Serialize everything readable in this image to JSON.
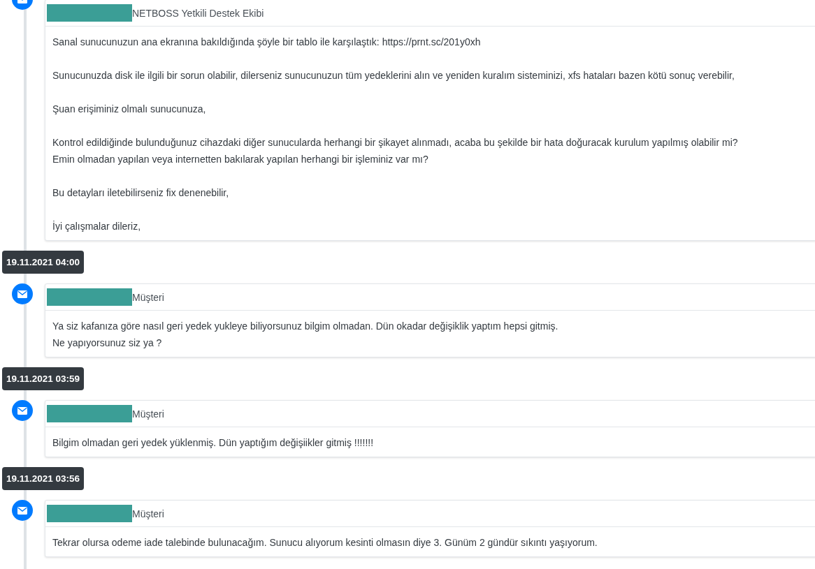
{
  "timeline": [
    {
      "kind": "message",
      "author": "NETBOSS Yetkili Destek Ekibi",
      "paragraphs": [
        [
          "Sanal sunucunuzun ana ekranına bakıldığında şöyle bir tablo ile karşılaştık: https://prnt.sc/201y0xh"
        ],
        [
          "Sunucunuzda disk ile ilgili bir sorun olabilir, dilerseniz sunucunuzun tüm yedeklerini alın ve yeniden kuralım sisteminizi, xfs hataları bazen kötü sonuç verebilir,"
        ],
        [
          "Şuan erişiminiz olmalı sunucunuza,"
        ],
        [
          "Kontrol edildiğinde bulunduğunuz cihazdaki diğer sunucularda herhangi bir şikayet alınmadı, acaba bu şekilde bir hata doğuracak kurulum yapılmış olabilir mi?",
          "Emin olmadan yapılan veya internetten bakılarak yapılan herhangi bir işleminiz var mı?"
        ],
        [
          "Bu detayları iletebilirseniz fix denenebilir,"
        ],
        [
          "İyi çalışmalar dileriz,"
        ]
      ]
    },
    {
      "kind": "date",
      "label": "19.11.2021 04:00"
    },
    {
      "kind": "message",
      "author": "Müşteri",
      "paragraphs": [
        [
          "Ya siz kafanıza göre nasıl geri yedek yukleye biliyorsunuz bilgim olmadan. Dün okadar değişiklik yaptım hepsi gitmiş.",
          "Ne yapıyorsunuz siz ya ?"
        ]
      ]
    },
    {
      "kind": "date",
      "label": "19.11.2021 03:59"
    },
    {
      "kind": "message",
      "author": "Müşteri",
      "paragraphs": [
        [
          "Bilgim olmadan geri yedek yüklenmiş. Dün yaptığım değişiikler gitmiş !!!!!!!"
        ]
      ]
    },
    {
      "kind": "date",
      "label": "19.11.2021 03:56"
    },
    {
      "kind": "message",
      "author": "Müşteri",
      "paragraphs": [
        [
          "Tekrar olursa odeme iade talebinde bulunacağım. Sunucu alıyorum kesinti olmasın diye 3. Günüm 2 gündür sıkıntı yaşıyorum."
        ]
      ]
    }
  ]
}
